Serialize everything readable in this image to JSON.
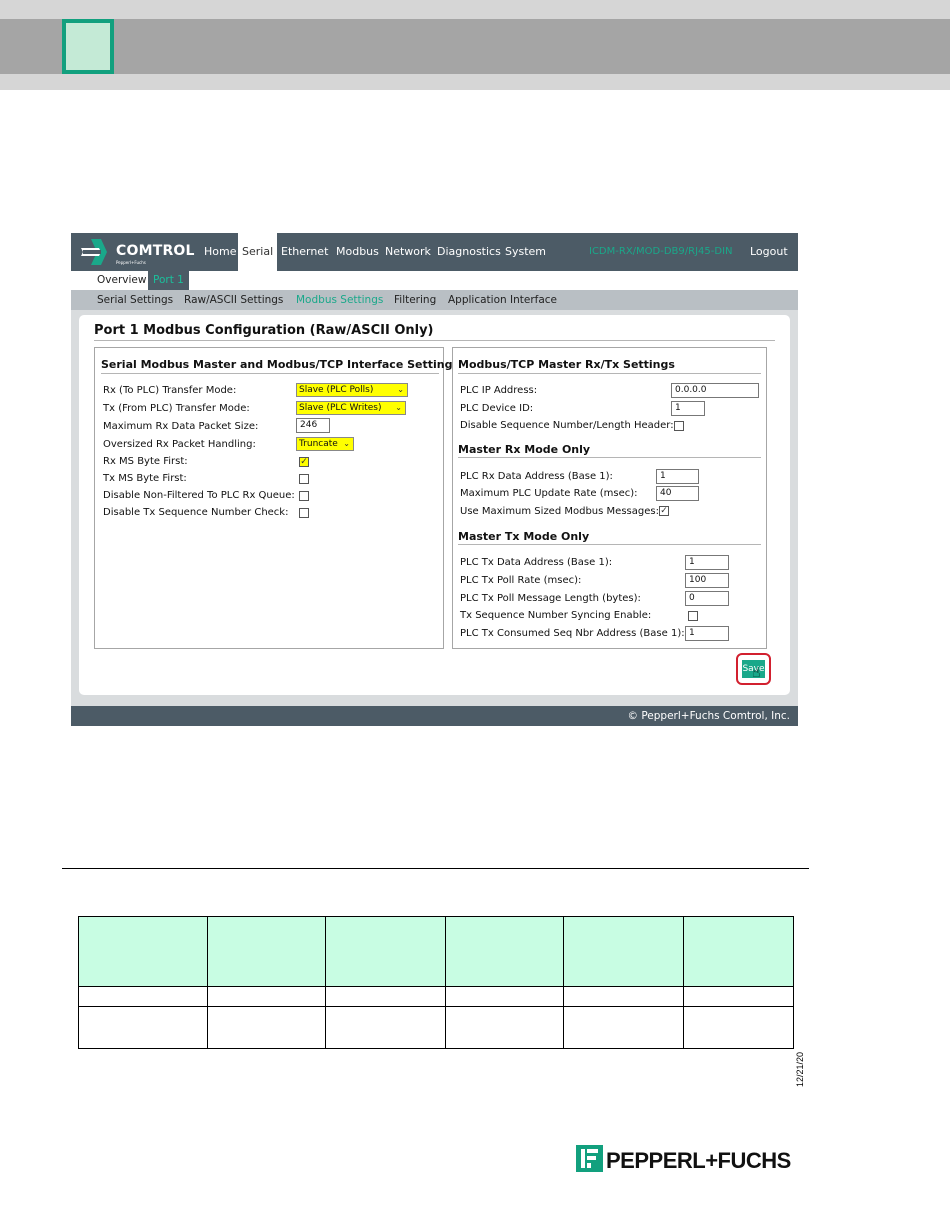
{
  "brand": {
    "name": "COMTROL",
    "subline": "Pepperl+Fuchs"
  },
  "nav": {
    "items": [
      "Home",
      "Serial",
      "Ethernet",
      "Modbus",
      "Network",
      "Diagnostics",
      "System"
    ],
    "active": "Serial",
    "device": "ICDM-RX/MOD-DB9/RJ45-DIN",
    "logout": "Logout"
  },
  "subnav": {
    "overview": "Overview",
    "port": "Port 1"
  },
  "tabs": {
    "items": [
      "Serial Settings",
      "Raw/ASCII Settings",
      "Modbus Settings",
      "Filtering",
      "Application Interface"
    ],
    "active": "Modbus Settings"
  },
  "page_title": "Port 1 Modbus Configuration (Raw/ASCII Only)",
  "left_panel": {
    "title": "Serial Modbus Master and Modbus/TCP Interface Settings",
    "rx_mode_label": "Rx (To PLC) Transfer Mode:",
    "rx_mode_value": "Slave (PLC Polls)",
    "tx_mode_label": "Tx (From PLC) Transfer Mode:",
    "tx_mode_value": "Slave (PLC Writes)",
    "max_rx_label": "Maximum Rx Data Packet Size:",
    "max_rx_value": "246",
    "oversized_label": "Oversized Rx Packet Handling:",
    "oversized_value": "Truncate",
    "rx_ms_label": "Rx MS Byte First:",
    "rx_ms_checked": true,
    "tx_ms_label": "Tx MS Byte First:",
    "tx_ms_checked": false,
    "disable_nonfiltered_label": "Disable Non-Filtered To PLC Rx Queue:",
    "disable_nonfiltered_checked": false,
    "disable_txseq_label": "Disable Tx Sequence Number Check:",
    "disable_txseq_checked": false
  },
  "right_panel": {
    "title": "Modbus/TCP Master Rx/Tx Settings",
    "plc_ip_label": "PLC IP Address:",
    "plc_ip_value": "0.0.0.0",
    "plc_device_label": "PLC Device ID:",
    "plc_device_value": "1",
    "disable_seq_label": "Disable Sequence Number/Length Header:",
    "disable_seq_checked": false,
    "rx_section": "Master Rx Mode Only",
    "rx_addr_label": "PLC Rx Data Address (Base 1):",
    "rx_addr_value": "1",
    "max_update_label": "Maximum PLC Update Rate (msec):",
    "max_update_value": "40",
    "use_max_label": "Use Maximum Sized Modbus Messages:",
    "use_max_checked": true,
    "tx_section": "Master Tx Mode Only",
    "tx_addr_label": "PLC Tx Data Address (Base 1):",
    "tx_addr_value": "1",
    "poll_rate_label": "PLC Tx Poll Rate (msec):",
    "poll_rate_value": "100",
    "poll_len_label": "PLC Tx Poll Message Length (bytes):",
    "poll_len_value": "0",
    "sync_label": "Tx Sequence Number Syncing Enable:",
    "sync_checked": false,
    "consumed_label": "PLC Tx Consumed Seq Nbr Address (Base 1):",
    "consumed_value": "1"
  },
  "save_label": "Save",
  "footer": "© Pepperl+Fuchs Comtrol, Inc.",
  "doc": {
    "date": "12/21/20",
    "logo_text": "PEPPERL+FUCHS"
  },
  "colors": {
    "nav_bg": "#4c5b66",
    "accent": "#1aa88a",
    "highlight": "#ffff00",
    "save_outline": "#d2202f",
    "table_header": "#c8fde3"
  }
}
